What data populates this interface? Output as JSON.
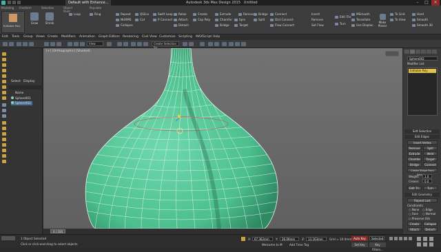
{
  "window": {
    "doc_tab": "Default with Enhance...",
    "title": "Autodesk 3ds Max Design 2015",
    "doc_name": "Untitled"
  },
  "ribbon": {
    "tabs": [
      "Modeling",
      "Freeform",
      "Selection",
      "Object Paint",
      "Populate"
    ],
    "col1": [
      "Repeat",
      "NURMS",
      "Collapse"
    ],
    "col2": [
      "QSlice",
      "Swift Loop",
      "Cut",
      "P Connect"
    ],
    "col3": [
      "Relax",
      "Attach",
      "Detach",
      "Create",
      "Cap Poly"
    ],
    "col4": [
      "Extrude",
      "Chamfer",
      "Bridge",
      "Spin",
      "Target"
    ],
    "col5": [
      "Remove",
      "Split",
      "Bridge",
      "Connect",
      "Dist Connect",
      "Flow Connect",
      "Insert",
      "Remove",
      "Set Flow"
    ],
    "col6": [
      "Edit Tris",
      "Turn"
    ],
    "col7": [
      "MSmooth",
      "Tessellate",
      "Use Displac."
    ],
    "col8": [
      "To Grid",
      "To View",
      "Make Planar"
    ],
    "col9": [
      "Hard",
      "Smooth",
      "Smooth 30"
    ],
    "left_big": [
      "Grow",
      "Shrink",
      "Loop",
      "Ring"
    ],
    "groups": [
      "Polygon Modeling",
      "Modify Selection",
      "Edit",
      "Geometry (All)",
      "Edges",
      "Loops",
      "Tris",
      "Subdivision",
      "Align",
      "Properties"
    ],
    "editable_poly_label": "Editable Poly"
  },
  "menu_tabs": [
    "Edit",
    "Tools",
    "Group",
    "Views",
    "Create",
    "Modifiers",
    "Animation",
    "Graph Editors",
    "Rendering",
    "Civil View",
    "Customize",
    "Scripting",
    "MAXScript",
    "Help"
  ],
  "toolbar": {
    "view_select": "View",
    "selection_set": "Create Selection Se"
  },
  "explorer": {
    "select": "Select",
    "display": "Display",
    "column": "Name",
    "items": [
      "Sphere001",
      "Sphere002"
    ]
  },
  "viewport": {
    "label": "[+] [Orthographic] [Shaded]"
  },
  "command_panel": {
    "object_name": "Sphere002",
    "modifier_list": "Modifier List",
    "stack_item": "Editable Poly",
    "soft_selection": "Soft Selection",
    "edit_edges": "Edit Edges",
    "insert_vertex": "Insert Vertex",
    "remove": "Remove",
    "split": "Split",
    "extrude": "Extrude",
    "weld": "Weld",
    "chamfer": "Chamfer",
    "target_weld": "Target Weld",
    "bridge": "Bridge",
    "connect": "Connect",
    "create_shape": "Create Shape From Selection",
    "weight_label": "Weight:",
    "weight_value": "1.0",
    "crease_label": "Crease:",
    "crease_value": "0.0",
    "edit_tri": "Edit Tri.",
    "turn": "Turn",
    "edit_geometry": "Edit Geometry",
    "repeat_last": "Repeat Last",
    "constraints": "Constraints",
    "none": "None",
    "edge": "Edge",
    "face": "Face",
    "normal": "Normal",
    "preserve_uvs": "Preserve UVs",
    "create": "Create",
    "collapse": "Collapse",
    "attach": "Attach",
    "detach": "Detach"
  },
  "timeslider": {
    "frame": "0 / 100"
  },
  "status": {
    "selected": "1 Object Selected",
    "prompt": "Click or click-and-drag to select objects",
    "x_label": "X:",
    "x_value": "67.362mm",
    "y_label": "Y:",
    "y_value": "26.09mm",
    "z_label": "Z:",
    "z_value": "13.163mm",
    "grid": "Grid = 10.0mm",
    "auto_key": "Auto Key",
    "selected_mode": "Selected",
    "set_key": "Set Key",
    "key_filters": "Key Filters...",
    "add_time_tag": "Add Time Tag",
    "welcome": "Welcome to M"
  },
  "colors": {
    "object": "#5fc9a0",
    "accent": "#3fb5b0",
    "stack_highlight": "#e0c24a"
  }
}
